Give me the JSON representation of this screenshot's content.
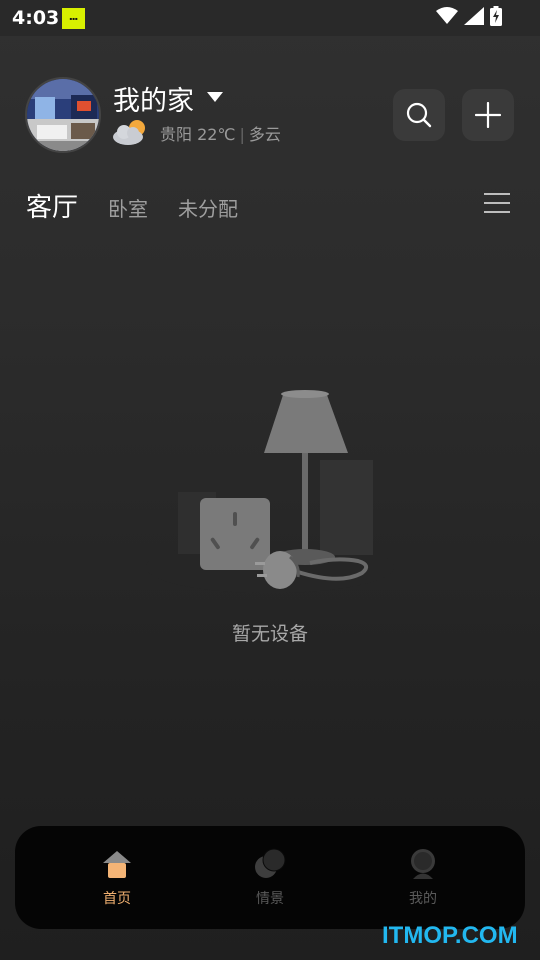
{
  "status_bar": {
    "time": "4:03",
    "icons": [
      "wifi-icon",
      "signal-icon",
      "battery-charging-icon"
    ]
  },
  "header": {
    "home_name": "我的家",
    "weather": {
      "city": "贵阳",
      "temperature": "22℃",
      "separator": "|",
      "condition": "多云",
      "icon": "partly-cloudy-icon"
    },
    "search_icon": "search-icon",
    "add_icon": "plus-icon"
  },
  "tabs": [
    {
      "label": "客厅",
      "active": true
    },
    {
      "label": "卧室",
      "active": false
    },
    {
      "label": "未分配",
      "active": false
    }
  ],
  "empty_state": {
    "message": "暂无设备"
  },
  "bottom_nav": [
    {
      "label": "首页",
      "icon": "home-icon",
      "active": true
    },
    {
      "label": "情景",
      "icon": "scene-icon",
      "active": false
    },
    {
      "label": "我的",
      "icon": "profile-icon",
      "active": false
    }
  ],
  "watermark": "ITMOP.COM",
  "colors": {
    "background": "#2c2c2c",
    "accent": "#f0b070",
    "nav_background": "#050505",
    "watermark": "#22b8f0"
  }
}
